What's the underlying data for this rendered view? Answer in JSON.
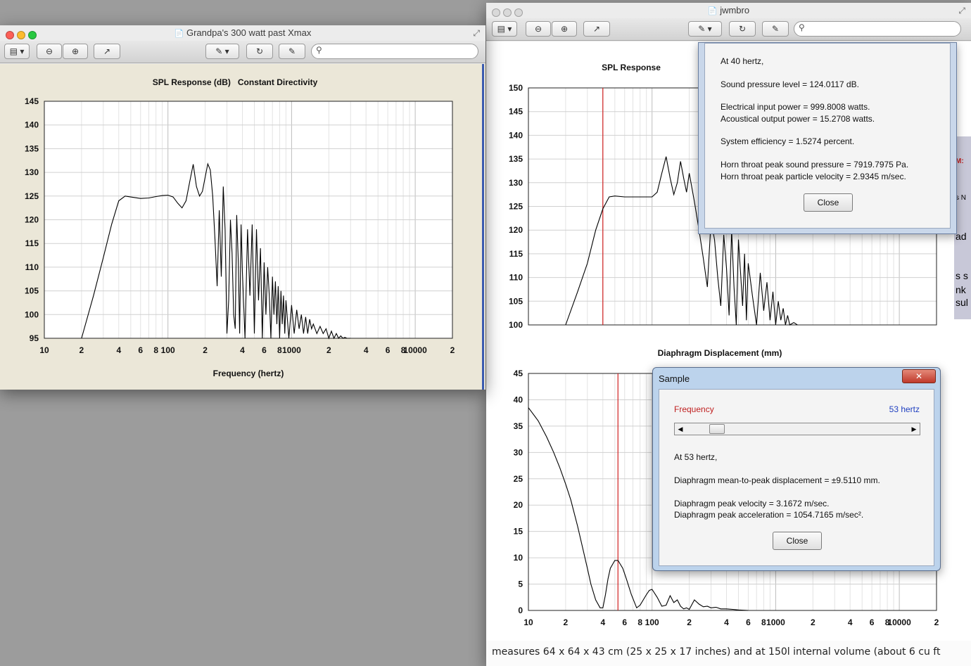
{
  "left_window": {
    "title": "Grandpa's 300 watt past Xmax",
    "chart_data": {
      "type": "line",
      "title": "SPL Response (dB)   Constant Directivity",
      "xlabel": "Frequency (hertz)",
      "ylabel": "",
      "x_scale": "log",
      "xlim": [
        10,
        20000
      ],
      "ylim": [
        95,
        145
      ],
      "yticks": [
        "145",
        "140",
        "135",
        "130",
        "125",
        "120",
        "115",
        "110",
        "105",
        "100",
        "95"
      ],
      "xticks": [
        {
          "label": "10",
          "x": 10
        },
        {
          "label": "2",
          "x": 20
        },
        {
          "label": "4",
          "x": 40
        },
        {
          "label": "6",
          "x": 60
        },
        {
          "label": "8",
          "x": 80
        },
        {
          "label": "100",
          "x": 100
        },
        {
          "label": "2",
          "x": 200
        },
        {
          "label": "4",
          "x": 400
        },
        {
          "label": "6",
          "x": 600
        },
        {
          "label": "8",
          "x": 800
        },
        {
          "label": "1000",
          "x": 1000
        },
        {
          "label": "2",
          "x": 2000
        },
        {
          "label": "4",
          "x": 4000
        },
        {
          "label": "6",
          "x": 6000
        },
        {
          "label": "8",
          "x": 8000
        },
        {
          "label": "10000",
          "x": 10000
        },
        {
          "label": "2",
          "x": 20000
        }
      ],
      "series": [
        {
          "x": [
            20,
            25,
            30,
            35,
            40,
            45,
            50,
            60,
            70,
            80,
            90,
            100,
            110,
            120,
            130,
            140,
            150,
            160,
            170,
            180,
            190,
            200,
            210,
            220,
            230,
            240,
            250,
            260,
            270,
            280,
            290,
            300,
            310,
            320,
            330,
            340,
            350,
            360,
            370,
            380,
            390,
            400,
            420,
            440,
            460,
            480,
            500,
            520,
            540,
            560,
            580,
            600,
            620,
            640,
            660,
            680,
            700,
            720,
            740,
            760,
            780,
            800,
            820,
            840,
            860,
            880,
            900,
            950,
            1000,
            1050,
            1100,
            1150,
            1200,
            1250,
            1300,
            1350,
            1400,
            1450,
            1500,
            1600,
            1700,
            1800,
            1900,
            2000,
            2100,
            2200,
            2300,
            2400,
            2500,
            2600,
            2700,
            2800,
            2900,
            3000
          ],
          "y": [
            95,
            104,
            112,
            119,
            124,
            125,
            124.8,
            124.5,
            124.6,
            124.9,
            125.1,
            125.2,
            124.8,
            123.5,
            122.5,
            124,
            128,
            131.7,
            127,
            125,
            126,
            129,
            131.8,
            130.5,
            125,
            116,
            106,
            122,
            108,
            127,
            118,
            96,
            103,
            120,
            113,
            100,
            97,
            121,
            112,
            96,
            119,
            109,
            95,
            118,
            104,
            119,
            96,
            118,
            103,
            114,
            95,
            111,
            100,
            110,
            104,
            95,
            108,
            100,
            107,
            98,
            106,
            95,
            105,
            98,
            104,
            96,
            103,
            95,
            102,
            96,
            101,
            97,
            100,
            96,
            99.5,
            96,
            99,
            97,
            98,
            96,
            97.5,
            96,
            97,
            95,
            96.5,
            95,
            96,
            95,
            95.5,
            95,
            95.2,
            95,
            95,
            95
          ]
        }
      ]
    }
  },
  "right_window": {
    "title": "jwmbro",
    "spl_chart": {
      "type": "line",
      "title": "SPL Response",
      "x_scale": "log",
      "xlim": [
        10,
        20000
      ],
      "ylim": [
        100,
        150
      ],
      "yticks": [
        "150",
        "145",
        "140",
        "135",
        "130",
        "125",
        "120",
        "115",
        "110",
        "105",
        "100"
      ],
      "marker_frequency_hz": 40,
      "series": [
        {
          "x": [
            20,
            25,
            30,
            35,
            40,
            45,
            50,
            60,
            70,
            80,
            90,
            100,
            110,
            120,
            130,
            140,
            150,
            160,
            170,
            180,
            190,
            200,
            220,
            240,
            260,
            280,
            300,
            320,
            340,
            360,
            380,
            400,
            420,
            440,
            460,
            480,
            500,
            520,
            540,
            560,
            580,
            600,
            650,
            700,
            750,
            800,
            850,
            900,
            950,
            1000,
            1050,
            1100,
            1150,
            1200,
            1250,
            1300,
            1400,
            1500
          ],
          "y": [
            100,
            107,
            113,
            120,
            124.5,
            127,
            127.2,
            127,
            127,
            127,
            127,
            127,
            128,
            132,
            135.5,
            131,
            127.5,
            130,
            134.5,
            131,
            128,
            132,
            126,
            120,
            114,
            108,
            122,
            118,
            110,
            104,
            119,
            112,
            102,
            120,
            108,
            100,
            118,
            111,
            104,
            115,
            101,
            113,
            106,
            100,
            111,
            103,
            109,
            101,
            107,
            100,
            105,
            101,
            103.5,
            100,
            102,
            100,
            100.5,
            100
          ]
        }
      ]
    },
    "displacement_chart": {
      "type": "line",
      "title": "Diaphragm Displacement (mm)",
      "x_scale": "log",
      "xlim": [
        10,
        20000
      ],
      "ylim": [
        0,
        45
      ],
      "yticks": [
        "45",
        "40",
        "35",
        "30",
        "25",
        "20",
        "15",
        "10",
        "5",
        "0"
      ],
      "xticks": [
        {
          "label": "10",
          "x": 10
        },
        {
          "label": "2",
          "x": 20
        },
        {
          "label": "4",
          "x": 40
        },
        {
          "label": "6",
          "x": 60
        },
        {
          "label": "8",
          "x": 80
        },
        {
          "label": "100",
          "x": 100
        },
        {
          "label": "2",
          "x": 200
        },
        {
          "label": "4",
          "x": 400
        },
        {
          "label": "6",
          "x": 600
        },
        {
          "label": "8",
          "x": 800
        },
        {
          "label": "1000",
          "x": 1000
        },
        {
          "label": "2",
          "x": 2000
        },
        {
          "label": "4",
          "x": 4000
        },
        {
          "label": "6",
          "x": 6000
        },
        {
          "label": "8",
          "x": 8000
        },
        {
          "label": "10000",
          "x": 10000
        },
        {
          "label": "2",
          "x": 20000
        }
      ],
      "marker_frequency_hz": 53,
      "series": [
        {
          "x": [
            10,
            12,
            14,
            16,
            18,
            20,
            22,
            25,
            28,
            30,
            32,
            35,
            38,
            40,
            42,
            44,
            46,
            50,
            53,
            58,
            62,
            68,
            75,
            80,
            90,
            95,
            100,
            110,
            120,
            130,
            140,
            150,
            160,
            170,
            180,
            190,
            200,
            220,
            240,
            260,
            280,
            300,
            330,
            360,
            400,
            450,
            500,
            600
          ],
          "y": [
            38.5,
            36,
            33,
            30,
            27,
            24,
            21,
            16,
            11,
            8,
            5,
            2,
            0.5,
            0.5,
            3,
            6,
            8,
            9.5,
            9.5,
            8,
            6,
            3,
            0.5,
            1,
            3,
            3.8,
            4,
            2.5,
            0.8,
            1,
            2.8,
            1.5,
            2,
            0.8,
            0.3,
            0.5,
            0.2,
            2,
            1.2,
            0.7,
            0.8,
            0.5,
            0.6,
            0.3,
            0.3,
            0.2,
            0.1,
            0
          ]
        }
      ]
    },
    "footer_text": "measures 64 x 64 x 43 cm (25 x 25 x 17 inches) and at 150l internal volume (about 6 cu ft",
    "behind_fragments": [
      "M:",
      "s N",
      "ad",
      "s s",
      "nk",
      "sul"
    ]
  },
  "dialog_spl": {
    "lines": [
      "At 40 hertz,",
      "Sound pressure level = 124.0117 dB.",
      "Electrical input power = 999.8008 watts.",
      "Acoustical output power = 15.2708 watts.",
      "System efficiency = 1.5274 percent.",
      "Horn throat peak sound pressure = 7919.7975 Pa.",
      "Horn throat peak particle velocity = 2.9345 m/sec."
    ],
    "close_label": "Close"
  },
  "dialog_sample": {
    "title": "Sample",
    "close_x": "✕",
    "frequency_label": "Frequency",
    "frequency_value": "53 hertz",
    "slider_fraction": 0.11,
    "lines": [
      "At 53 hertz,",
      "Diaphragm mean-to-peak displacement = ±9.5110 mm.",
      "Diaphragm peak velocity = 3.1672 m/sec.",
      "Diaphragm peak acceleration = 1054.7165 m/sec²."
    ],
    "close_label": "Close"
  },
  "toolbar": {
    "search_icon": "magnifier-icon",
    "icons": [
      "sidebar-icon",
      "zoom-out-icon",
      "zoom-in-icon",
      "share-icon",
      "annotate-icon",
      "rotate-icon",
      "edit-icon"
    ]
  },
  "colors": {
    "marker": "#d02020",
    "frequency_label": "#c02020",
    "frequency_value": "#2040c0",
    "left_chart_bg": "#ebe7d8"
  }
}
